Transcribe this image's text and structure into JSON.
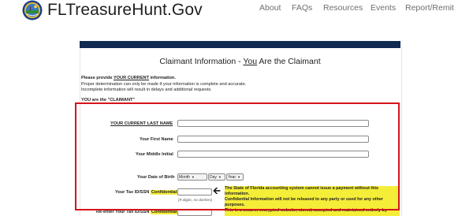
{
  "header": {
    "site_title": "FLTreasureHunt.Gov",
    "nav": [
      "About",
      "FAQs",
      "Resources",
      "Events",
      "Report/Remit"
    ]
  },
  "form": {
    "title_prefix": "Claimant Information - ",
    "title_you": "You",
    "title_suffix": " Are the Claimant",
    "intro": {
      "line1_prefix": "Please provide ",
      "line1_emphasis": "YOUR CURRENT",
      "line1_suffix": " information.",
      "line2": "Proper determination can only be made if your information is complete and accurate.",
      "line3": "Incomplete information will result in delays and additional requests.",
      "line4": "YOU are the \"CLAIMANT\""
    },
    "labels": {
      "last_name": "YOUR CURRENT LAST NAME",
      "first_name": "Your First Name",
      "middle_initial": "Your Middle Initial",
      "dob": "Your Date of Birth",
      "tax_id": "Your Tax ID/SSN ",
      "tax_confidential": "Confidential",
      "reenter": "Re-enter Your Tax ID/SSN ",
      "reenter_confidential": "Confidential"
    },
    "dob_selects": {
      "month": "Month",
      "day": "Day",
      "year": "Year"
    },
    "tax_hint": "(9 digits, no dashes)",
    "notice": {
      "line1": "The State of Florida accounting system cannot issue a payment without this",
      "line2": "information.",
      "line3": "Confidential Information will not be released to any party or used for any other",
      "line4": "purposes.",
      "line5": "This is a secure, encrypted website, stored, accepted and maintained entirely by"
    }
  },
  "colors": {
    "navy_bar": "#102a52",
    "highlight": "#f5ee38",
    "annotation_frame": "#d4141c"
  },
  "icons": {
    "seal": "florida-seal-icon",
    "arrow": "left-arrow-icon"
  }
}
